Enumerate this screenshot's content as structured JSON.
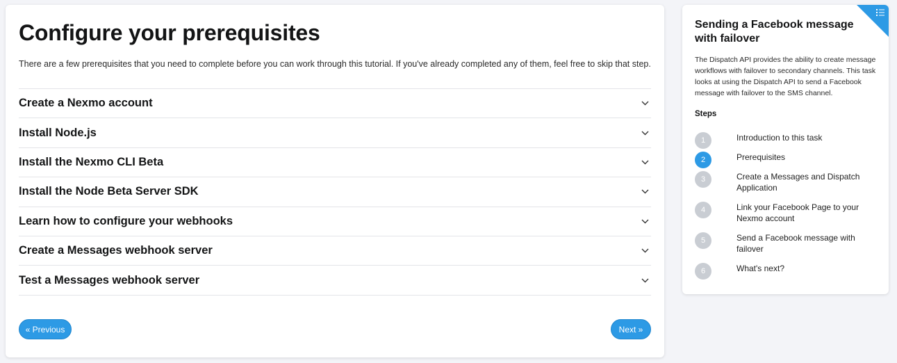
{
  "main": {
    "title": "Configure your prerequisites",
    "intro": "There are a few prerequisites that you need to complete before you can work through this tutorial. If you've already completed any of them, feel free to skip that step.",
    "sections": [
      {
        "label": "Create a Nexmo account"
      },
      {
        "label": "Install Node.js"
      },
      {
        "label": "Install the Nexmo CLI Beta"
      },
      {
        "label": "Install the Node Beta Server SDK"
      },
      {
        "label": "Learn how to configure your webhooks"
      },
      {
        "label": "Create a Messages webhook server"
      },
      {
        "label": "Test a Messages webhook server"
      }
    ],
    "prev_label": "« Previous",
    "next_label": "Next »"
  },
  "sidebar": {
    "corner_icon": "list-icon",
    "title": "Sending a Facebook message with failover",
    "description": "The Dispatch API provides the ability to create message workflows with failover to secondary channels. This task looks at using the Dispatch API to send a Facebook message with failover to the SMS channel.",
    "steps_heading": "Steps",
    "steps": [
      {
        "number": "1",
        "label": "Introduction to this task",
        "active": false
      },
      {
        "number": "2",
        "label": "Prerequisites",
        "active": true
      },
      {
        "number": "3",
        "label": "Create a Messages and Dispatch Application",
        "active": false
      },
      {
        "number": "4",
        "label": "Link your Facebook Page to your Nexmo account",
        "active": false
      },
      {
        "number": "5",
        "label": "Send a Facebook message with failover",
        "active": false
      },
      {
        "number": "6",
        "label": "What's next?",
        "active": false
      }
    ]
  },
  "colors": {
    "accent": "#2d9ae5",
    "inactive_step": "#c9cdd3",
    "background": "#f3f4f8"
  }
}
